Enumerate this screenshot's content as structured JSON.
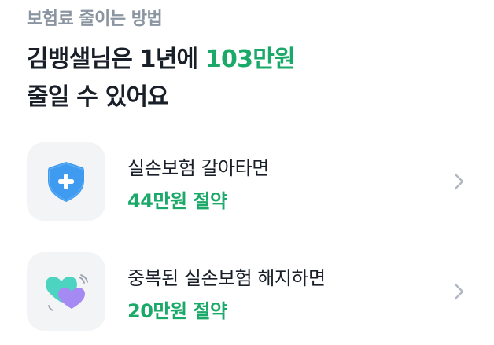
{
  "section_label": "보험료 줄이는 방법",
  "headline": {
    "line1_prefix": "김뱅샐님은 1년에 ",
    "line1_amount": "103만원",
    "line2": "줄일 수 있어요"
  },
  "items": [
    {
      "icon": "shield-plus-icon",
      "title": "실손보험 갈아타면",
      "saving": "44만원 절약"
    },
    {
      "icon": "hearts-icon",
      "title": "중복된 실손보험 해지하면",
      "saving": "20만원 절약"
    }
  ],
  "colors": {
    "accent": "#1ba96a",
    "muted": "#8b95a1",
    "text": "#191f28",
    "icon_box": "#f2f4f6",
    "shield": "#3f9bf0",
    "heart_teal": "#4dd4c0",
    "heart_purple": "#a48af2"
  }
}
